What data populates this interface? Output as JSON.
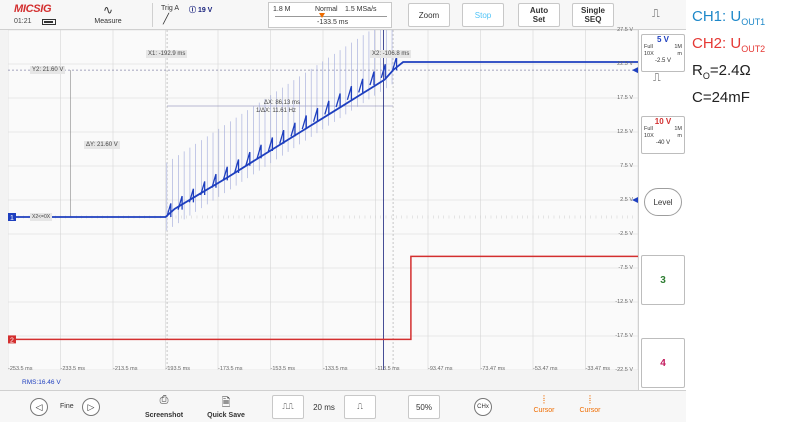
{
  "header": {
    "logo": "MICSIG",
    "time": "01:21",
    "measure_label": "Measure",
    "trigger": {
      "label": "Trig",
      "source": "A",
      "level": "19 V",
      "edge": "╱"
    },
    "timebase": {
      "time_div": "1.8 M",
      "mode": "Normal",
      "sample_rate": "1.5 MSa/s",
      "position": "-133.5 ms"
    },
    "buttons": {
      "zoom": "Zoom",
      "stop": "Stop",
      "auto_set": "Auto\nSet",
      "single_seq": "Single\nSEQ"
    }
  },
  "channels": {
    "ch1": {
      "scale": "5 V",
      "coupling_a": "Full",
      "coupling_b": "1M",
      "probe": "10X",
      "unit": "m",
      "offset": "-2.5 V",
      "color": "#1e3fbf"
    },
    "ch2": {
      "scale": "10 V",
      "coupling_a": "Full",
      "coupling_b": "1M",
      "probe": "10X",
      "unit": "m",
      "offset": "-40 V",
      "color": "#d32f2f"
    },
    "ch3": {
      "label": "3",
      "color": "#2e7d32"
    },
    "ch4": {
      "label": "4",
      "color": "#c2185b"
    },
    "level_label": "Level"
  },
  "grid": {
    "v_labels": [
      "27.5 V",
      "22.5 V",
      "17.5 V",
      "12.5 V",
      "7.5 V",
      "2.5 V",
      "-2.5 V",
      "-7.5 V",
      "-12.5 V",
      "-17.5 V",
      "-22.5 V"
    ],
    "t_labels": [
      "-253.5 ms",
      "-233.5 ms",
      "-213.5 ms",
      "-193.5 ms",
      "-173.5 ms",
      "-153.5 ms",
      "-133.5 ms",
      "-113.5 ms",
      "-93.47 ms",
      "-73.47 ms",
      "-53.47 ms",
      "-33.47 ms"
    ],
    "rms": "RMS:16.46 V",
    "ch1_marker": "1",
    "ch2_marker": "2",
    "ch1_ground_label": "X2<=0X"
  },
  "cursors": {
    "x1": "X1: -192.9 ms",
    "x2": "X2: -106.8 ms",
    "dx": "ΔX: 86.13 ms",
    "inv_dx": "1/ΔX: 11.61 Hz",
    "y2": "Y2: 21.60 V",
    "dy": "ΔY: 21.60 V"
  },
  "footer": {
    "fine": "Fine",
    "screenshot": "Screenshot",
    "quick_save": "Quick Save",
    "time_div": "20 ms",
    "percent": "50%",
    "chx": "CHx",
    "cursor1": "Cursor",
    "cursor2": "Cursor"
  },
  "notes": {
    "ch1_prefix": "CH1: U",
    "ch1_sub": "OUT1",
    "ch2_prefix": "CH2: U",
    "ch2_sub": "OUT2",
    "ro_prefix": "R",
    "ro_sub": "O",
    "ro_value": "=2.4Ω",
    "c_value": "C=24mF"
  },
  "chart_data": {
    "type": "line",
    "x_unit": "ms",
    "y_unit": "V",
    "xlim": [
      -253.5,
      -13.5
    ],
    "ylim": [
      -22.5,
      27.5
    ],
    "grid": true,
    "series": [
      {
        "name": "CH1",
        "color": "#1e3fbf",
        "x": [
          -253.5,
          -193.5,
          -190.0,
          -180.0,
          -170.0,
          -160.0,
          -150.0,
          -140.0,
          -130.0,
          -120.0,
          -110.0,
          -106.8,
          -103.0,
          -90.0,
          -60.0,
          -30.0,
          -13.5
        ],
        "values": [
          0.0,
          0.0,
          1.2,
          3.5,
          5.8,
          8.2,
          10.6,
          13.0,
          15.4,
          17.8,
          20.2,
          21.6,
          22.8,
          22.8,
          22.8,
          22.8,
          22.8
        ]
      },
      {
        "name": "CH2",
        "color": "#d32f2f",
        "x": [
          -253.5,
          -100.0,
          -100.0,
          -13.5
        ],
        "values": [
          -18.0,
          -18.0,
          -5.8,
          -5.8
        ]
      }
    ]
  }
}
